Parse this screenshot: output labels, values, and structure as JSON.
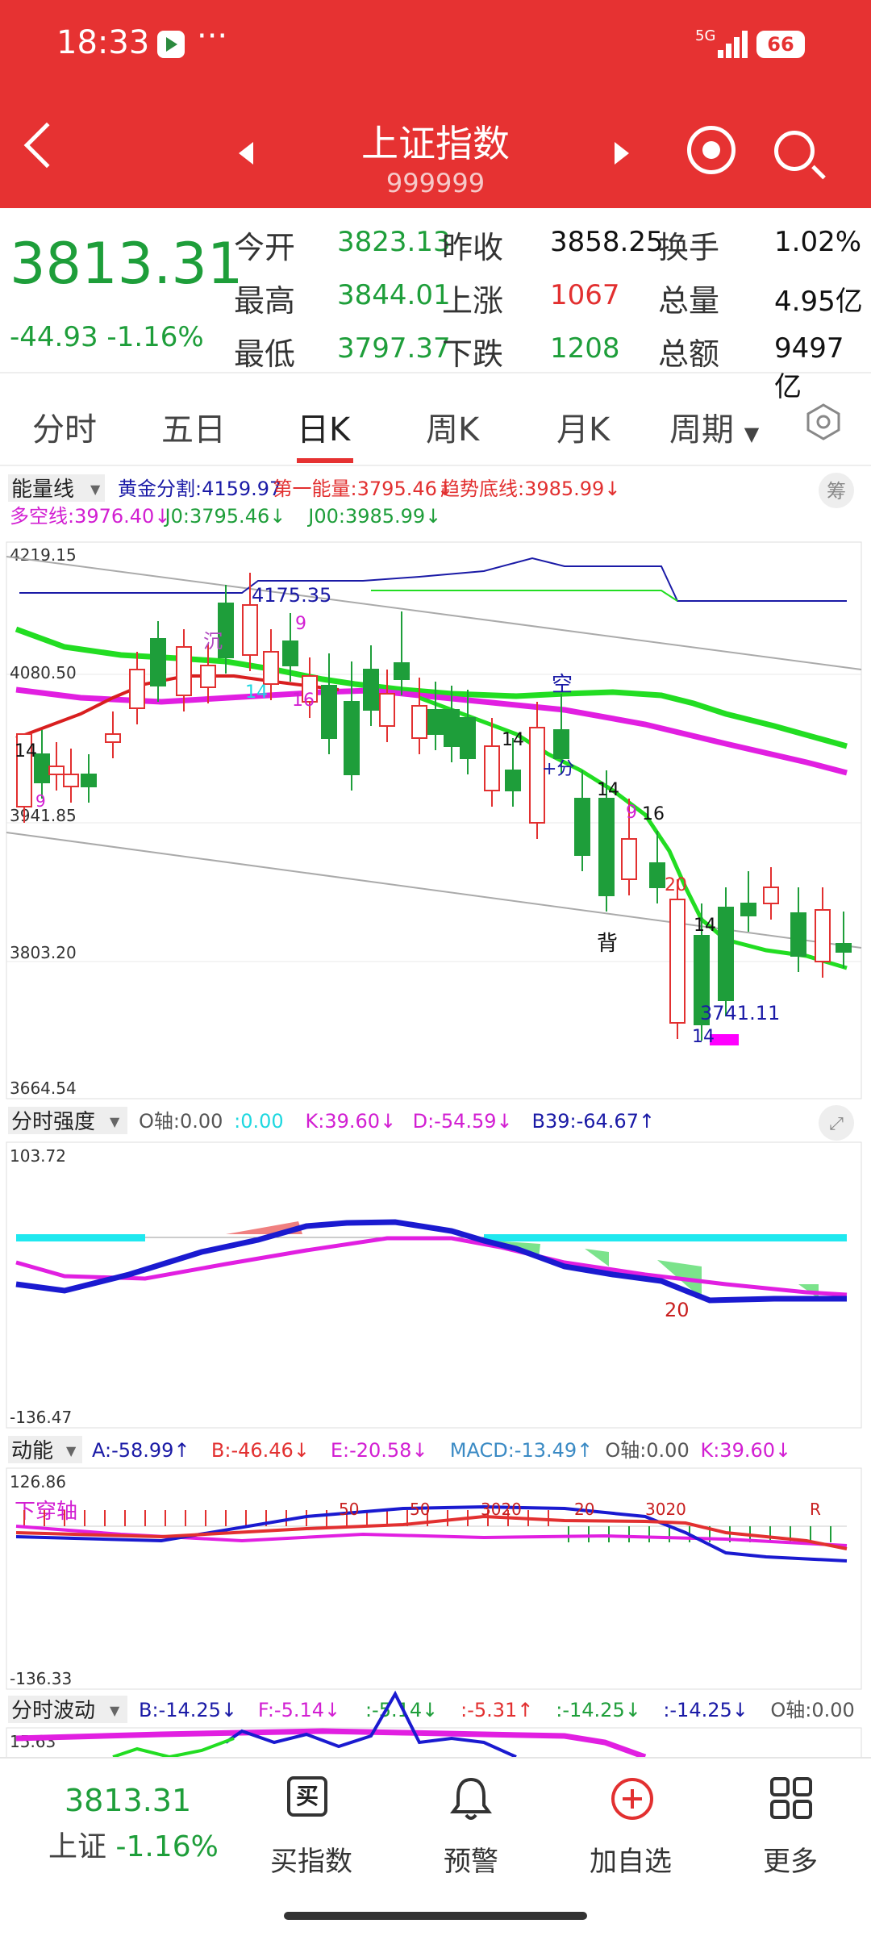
{
  "status": {
    "time": "18:33",
    "dots": "···",
    "network": "5G",
    "battery": "66"
  },
  "header": {
    "title": "上证指数",
    "code": "999999"
  },
  "quote": {
    "price": "3813.31",
    "change": "-44.93",
    "change_pct": "-1.16%",
    "rows": [
      [
        {
          "label": "今开",
          "value": "3823.13",
          "color": "green"
        },
        {
          "label": "昨收",
          "value": "3858.25",
          "color": "black"
        },
        {
          "label": "换手",
          "value": "1.02%",
          "color": "black"
        }
      ],
      [
        {
          "label": "最高",
          "value": "3844.01",
          "color": "green"
        },
        {
          "label": "上涨",
          "value": "1067",
          "color": "red"
        },
        {
          "label": "总量",
          "value": "4.95亿",
          "color": "black"
        }
      ],
      [
        {
          "label": "最低",
          "value": "3797.37",
          "color": "green"
        },
        {
          "label": "下跌",
          "value": "1208",
          "color": "green"
        },
        {
          "label": "总额",
          "value": "9497亿",
          "color": "black"
        }
      ]
    ]
  },
  "tabs": [
    "分时",
    "五日",
    "日K",
    "周K",
    "月K",
    "周期"
  ],
  "active_tab": "日K",
  "main": {
    "indicator": "能量线",
    "legend1": [
      {
        "t": "黄金分割:4159.97",
        "c": "#1a1aa6"
      },
      {
        "t": "第一能量:3795.46↓",
        "c": "#e23030"
      },
      {
        "t": "趋势底线:3985.99↓",
        "c": "#e23030"
      }
    ],
    "legend2": [
      {
        "t": "多空线:3976.40↓",
        "c": "#d21fd2"
      },
      {
        "t": "J0:3795.46↓",
        "c": "#1e9e3a"
      },
      {
        "t": "J00:3985.99↓",
        "c": "#1e9e3a"
      }
    ],
    "chip_button": "筹",
    "y_labels": [
      "4219.15",
      "4080.50",
      "3941.85",
      "3803.20",
      "3664.54"
    ],
    "annotations": [
      "4175.35",
      "3741.11",
      "沉",
      "空",
      "+分",
      "背",
      "9",
      "14",
      "16",
      "20"
    ]
  },
  "strength": {
    "indicator": "分时强度",
    "legend": [
      {
        "t": "O轴:0.00",
        "c": "#555"
      },
      {
        "t": ":0.00",
        "c": "#1fd8e0"
      },
      {
        "t": "K:39.60↓",
        "c": "#d21fd2"
      },
      {
        "t": "D:-54.59↓",
        "c": "#d21fd2"
      },
      {
        "t": "B39:-64.67↑",
        "c": "#1a1aa6"
      }
    ],
    "y_top": "103.72",
    "y_bottom": "-136.47",
    "mark": "20"
  },
  "energy": {
    "indicator": "动能",
    "legend": [
      {
        "t": "A:-58.99↑",
        "c": "#1a1aa6"
      },
      {
        "t": "B:-46.46↓",
        "c": "#e23030"
      },
      {
        "t": "E:-20.58↓",
        "c": "#d21fd2"
      },
      {
        "t": "MACD:-13.49↑",
        "c": "#3a8ac4"
      },
      {
        "t": "O轴:0.00",
        "c": "#555"
      },
      {
        "t": "K:39.60↓",
        "c": "#d21fd2"
      }
    ],
    "y_top": "126.86",
    "y_bottom": "-136.33",
    "label": "下穿轴"
  },
  "wave": {
    "indicator": "分时波动",
    "legend": [
      {
        "t": "B:-14.25↓",
        "c": "#1a1aa6"
      },
      {
        "t": "F:-5.14↓",
        "c": "#d21fd2"
      },
      {
        "t": ":-5.14↓",
        "c": "#1e9e3a"
      },
      {
        "t": ":-5.31↑",
        "c": "#e23030"
      },
      {
        "t": ":-14.25↓",
        "c": "#1e9e3a"
      },
      {
        "t": ":-14.25↓",
        "c": "#1a1aa6"
      },
      {
        "t": "O轴:0.00",
        "c": "#555"
      }
    ],
    "y_top": "15.63"
  },
  "bottom": {
    "price": "3813.31",
    "name": "上证",
    "pct": "-1.16%",
    "items": [
      "买指数",
      "预警",
      "加自选",
      "更多"
    ],
    "buy_icon": "买"
  }
}
